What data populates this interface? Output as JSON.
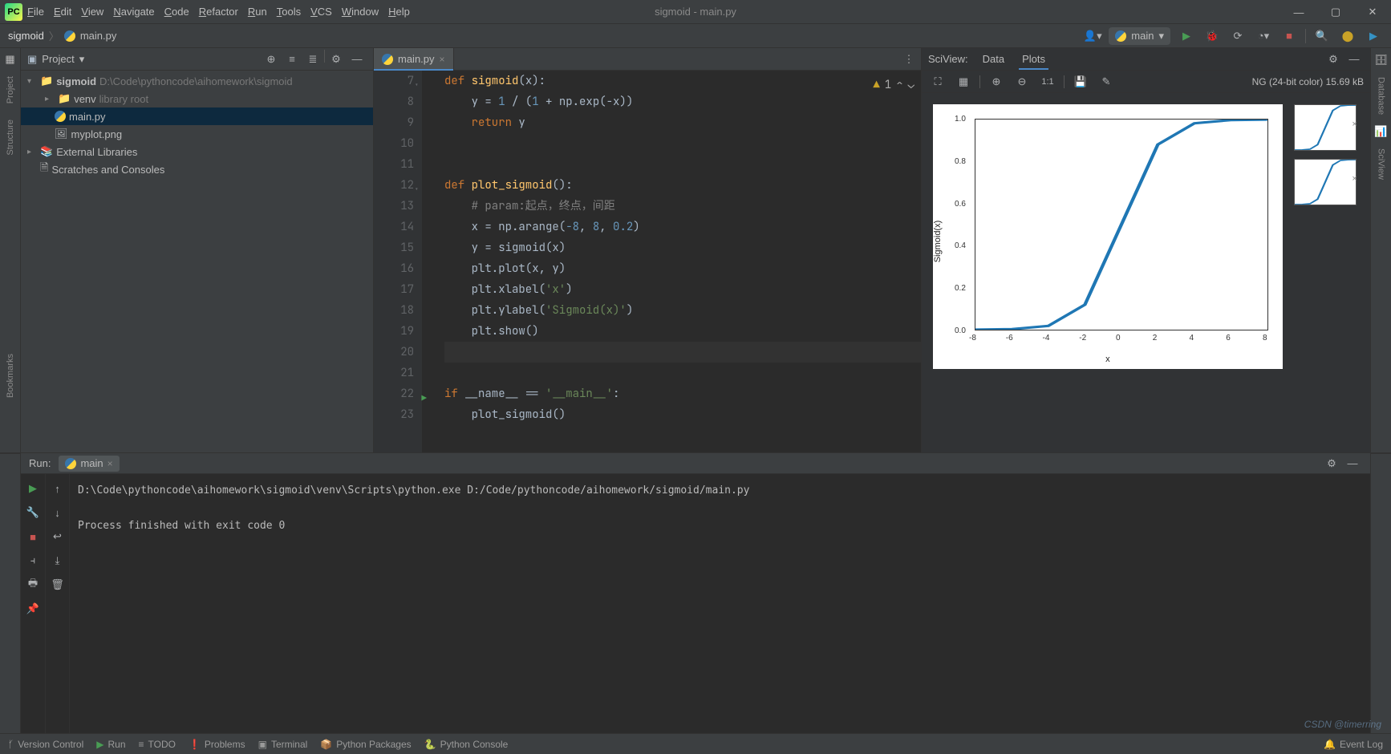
{
  "window": {
    "title": "sigmoid - main.py"
  },
  "menu": [
    "File",
    "Edit",
    "View",
    "Navigate",
    "Code",
    "Refactor",
    "Run",
    "Tools",
    "VCS",
    "Window",
    "Help"
  ],
  "breadcrumb": {
    "project": "sigmoid",
    "file": "main.py"
  },
  "runconfig": {
    "name": "main"
  },
  "project": {
    "title": "Project",
    "tree": {
      "root": "sigmoid",
      "rootPath": "D:\\Code\\pythoncode\\aihomework\\sigmoid",
      "venv": "venv",
      "venvNote": "library root",
      "files": [
        "main.py",
        "myplot.png"
      ],
      "ext": "External Libraries",
      "scratch": "Scratches and Consoles"
    }
  },
  "tabs": {
    "active": "main.py"
  },
  "editor": {
    "warnCount": "1",
    "lines": [
      {
        "n": 7,
        "html": "<span class='kw'>def</span> <span class='fn'>sigmoid</span>(x):"
      },
      {
        "n": 8,
        "html": "    y = <span class='num'>1</span> / (<span class='num'>1</span> + np.exp(-x))"
      },
      {
        "n": 9,
        "html": "    <span class='kw'>return</span> y"
      },
      {
        "n": 10,
        "html": ""
      },
      {
        "n": 11,
        "html": ""
      },
      {
        "n": 12,
        "html": "<span class='kw'>def</span> <span class='fn'>plot_sigmoid</span>():"
      },
      {
        "n": 13,
        "html": "    <span class='cmt'># param:起点，终点，间距</span>"
      },
      {
        "n": 14,
        "html": "    x = np.arange(<span class='num'>-8</span>, <span class='num'>8</span>, <span class='num'>0.2</span>)"
      },
      {
        "n": 15,
        "html": "    y = sigmoid(x)"
      },
      {
        "n": 16,
        "html": "    plt.plot(x, y)"
      },
      {
        "n": 17,
        "html": "    plt.xlabel(<span class='str'>'x'</span>)"
      },
      {
        "n": 18,
        "html": "    plt.ylabel(<span class='str'>'Sigmoid(x)'</span>)"
      },
      {
        "n": 19,
        "html": "    plt.show()"
      },
      {
        "n": 20,
        "html": "",
        "caret": true
      },
      {
        "n": 21,
        "html": ""
      },
      {
        "n": 22,
        "html": "<span class='kw'>if</span> __name__ == <span class='str'>'__main__'</span>:",
        "run": true
      },
      {
        "n": 23,
        "html": "    plot_sigmoid()"
      }
    ]
  },
  "sciview": {
    "label": "SciView:",
    "tabData": "Data",
    "tabPlots": "Plots",
    "status": "NG (24-bit color) 15.69 kB",
    "oneToOne": "1:1"
  },
  "chart_data": {
    "type": "line",
    "title": "",
    "xlabel": "x",
    "ylabel": "Sigmoid(x)",
    "x_ticks": [
      -8,
      -6,
      -4,
      -2,
      0,
      2,
      4,
      6,
      8
    ],
    "y_ticks": [
      0.0,
      0.2,
      0.4,
      0.6,
      0.8,
      1.0
    ],
    "xlim": [
      -8,
      8
    ],
    "ylim": [
      0,
      1
    ],
    "series": [
      {
        "name": "sigmoid",
        "x": [
          -8,
          -6,
          -4,
          -2,
          0,
          2,
          4,
          6,
          8
        ],
        "y": [
          0.0003,
          0.0025,
          0.018,
          0.119,
          0.5,
          0.881,
          0.982,
          0.9975,
          0.9997
        ]
      }
    ]
  },
  "run": {
    "title": "Run:",
    "tab": "main",
    "console_lines": [
      "D:\\Code\\pythoncode\\aihomework\\sigmoid\\venv\\Scripts\\python.exe D:/Code/pythoncode/aihomework/sigmoid/main.py",
      "",
      "Process finished with exit code 0"
    ]
  },
  "statusbar": {
    "items": [
      "Version Control",
      "Run",
      "TODO",
      "Problems",
      "Terminal",
      "Python Packages",
      "Python Console"
    ],
    "eventlog": "Event Log"
  },
  "strips": {
    "left": [
      "Project",
      "Structure",
      "Bookmarks"
    ],
    "right": [
      "Database",
      "SciView"
    ]
  },
  "watermark": "CSDN @timerring"
}
